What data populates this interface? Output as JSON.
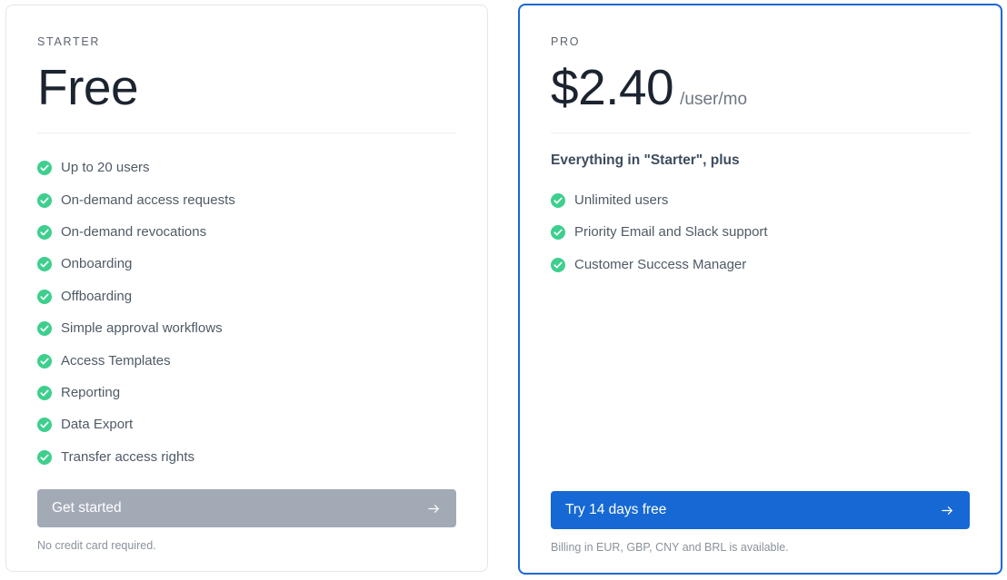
{
  "accent_color": "#1668d4",
  "check_color": "#3ecf8e",
  "muted_button_color": "#a2aab6",
  "plans": [
    {
      "tag": "STARTER",
      "price": "Free",
      "price_suffix": "",
      "plus_heading": "",
      "features": [
        "Up to 20 users",
        "On-demand access requests",
        "On-demand revocations",
        "Onboarding",
        "Offboarding",
        "Simple approval workflows",
        "Access Templates",
        "Reporting",
        "Data Export",
        "Transfer access rights"
      ],
      "cta_label": "Get started",
      "fine_print": "No credit card required."
    },
    {
      "tag": "PRO",
      "price": "$2.40",
      "price_suffix": "/user/mo",
      "plus_heading": "Everything in \"Starter\", plus",
      "features": [
        "Unlimited users",
        "Priority Email and Slack support",
        "Customer Success Manager"
      ],
      "cta_label": "Try 14 days free",
      "fine_print": "Billing in EUR, GBP, CNY and BRL is available."
    }
  ]
}
